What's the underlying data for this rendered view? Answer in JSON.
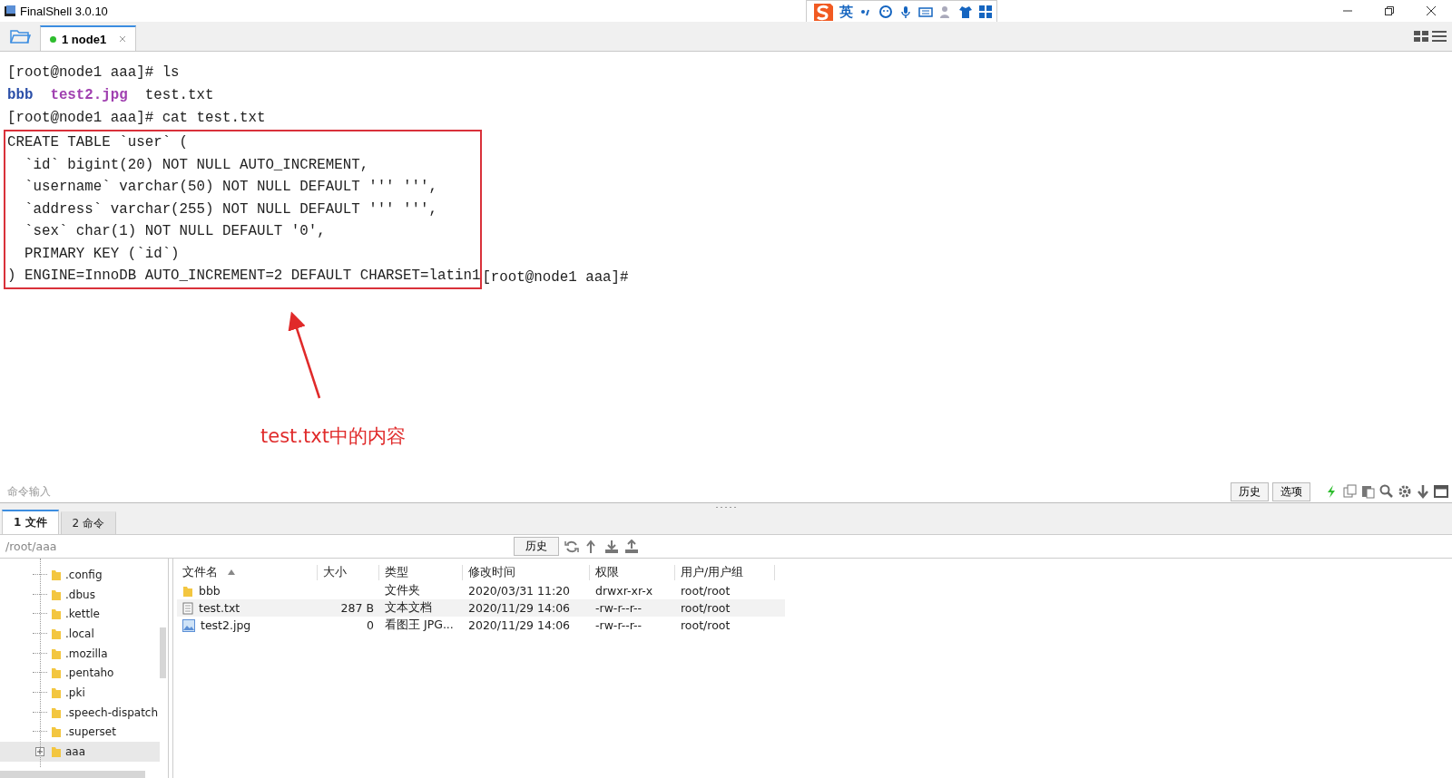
{
  "window": {
    "title": "FinalShell 3.0.10"
  },
  "ime_toolbar": {
    "mode": "英"
  },
  "session_tabs": [
    {
      "label": "1 node1",
      "selected": true,
      "connected": true
    }
  ],
  "terminal": {
    "lines": [
      {
        "segments": [
          {
            "text": "[root@node1 aaa]# ls",
            "kind": "plain"
          }
        ]
      },
      {
        "segments": [
          {
            "text": "bbb",
            "kind": "directory"
          },
          {
            "text": "test2.jpg",
            "kind": "image"
          },
          {
            "text": "test.txt",
            "kind": "plain"
          }
        ]
      },
      {
        "segments": [
          {
            "text": "[root@node1 aaa]# cat test.txt",
            "kind": "plain"
          }
        ]
      }
    ],
    "highlighted_lines": [
      "CREATE TABLE `user` (",
      "  `id` bigint(20) NOT NULL AUTO_INCREMENT,",
      "  `username` varchar(50) NOT NULL DEFAULT ''' ''',",
      "  `address` varchar(255) NOT NULL DEFAULT ''' ''',",
      "  `sex` char(1) NOT NULL DEFAULT '0',",
      "  PRIMARY KEY (`id`)",
      ") ENGINE=InnoDB AUTO_INCREMENT=2 DEFAULT CHARSET=latin1"
    ],
    "trailing_prompt": "[root@node1 aaa]#"
  },
  "annotation": {
    "label": "test.txt中的内容"
  },
  "command_bar": {
    "placeholder": "命令输入",
    "buttons": [
      "历史",
      "选项"
    ]
  },
  "panel_tabs": [
    {
      "label": "1 文件",
      "selected": true
    },
    {
      "label": "2 命令",
      "selected": false
    }
  ],
  "path_bar": {
    "value": "/root/aaa",
    "button": "历史"
  },
  "tree": {
    "items": [
      {
        "label": ".config",
        "has_children": false,
        "selected": false
      },
      {
        "label": ".dbus",
        "has_children": false,
        "selected": false
      },
      {
        "label": ".kettle",
        "has_children": false,
        "selected": false
      },
      {
        "label": ".local",
        "has_children": false,
        "selected": false
      },
      {
        "label": ".mozilla",
        "has_children": false,
        "selected": false
      },
      {
        "label": ".pentaho",
        "has_children": false,
        "selected": false
      },
      {
        "label": ".pki",
        "has_children": false,
        "selected": false
      },
      {
        "label": ".speech-dispatch",
        "has_children": false,
        "selected": false
      },
      {
        "label": ".superset",
        "has_children": false,
        "selected": false
      },
      {
        "label": "aaa",
        "has_children": true,
        "selected": true
      }
    ]
  },
  "files": {
    "columns": [
      {
        "label": "文件名",
        "sorted": true
      },
      {
        "label": "大小",
        "sorted": false
      },
      {
        "label": "类型",
        "sorted": false
      },
      {
        "label": "修改时间",
        "sorted": false
      },
      {
        "label": "权限",
        "sorted": false
      },
      {
        "label": "用户/用户组",
        "sorted": false
      }
    ],
    "rows": [
      {
        "kind": "folder",
        "name": "bbb",
        "type": "文件夹",
        "modified": "2020/03/31 11:20",
        "permissions": "drwxr-xr-x",
        "owner": "root/root",
        "selected": false
      },
      {
        "kind": "text",
        "name": "test.txt",
        "size": "287 B",
        "type": "文本文档",
        "modified": "2020/11/29 14:06",
        "permissions": "-rw-r--r--",
        "owner": "root/root",
        "selected": true
      },
      {
        "kind": "image",
        "name": "test2.jpg",
        "size": "0",
        "type": "看图王 JPG...",
        "modified": "2020/11/29 14:06",
        "permissions": "-rw-r--r--",
        "owner": "root/root",
        "selected": false
      }
    ]
  }
}
